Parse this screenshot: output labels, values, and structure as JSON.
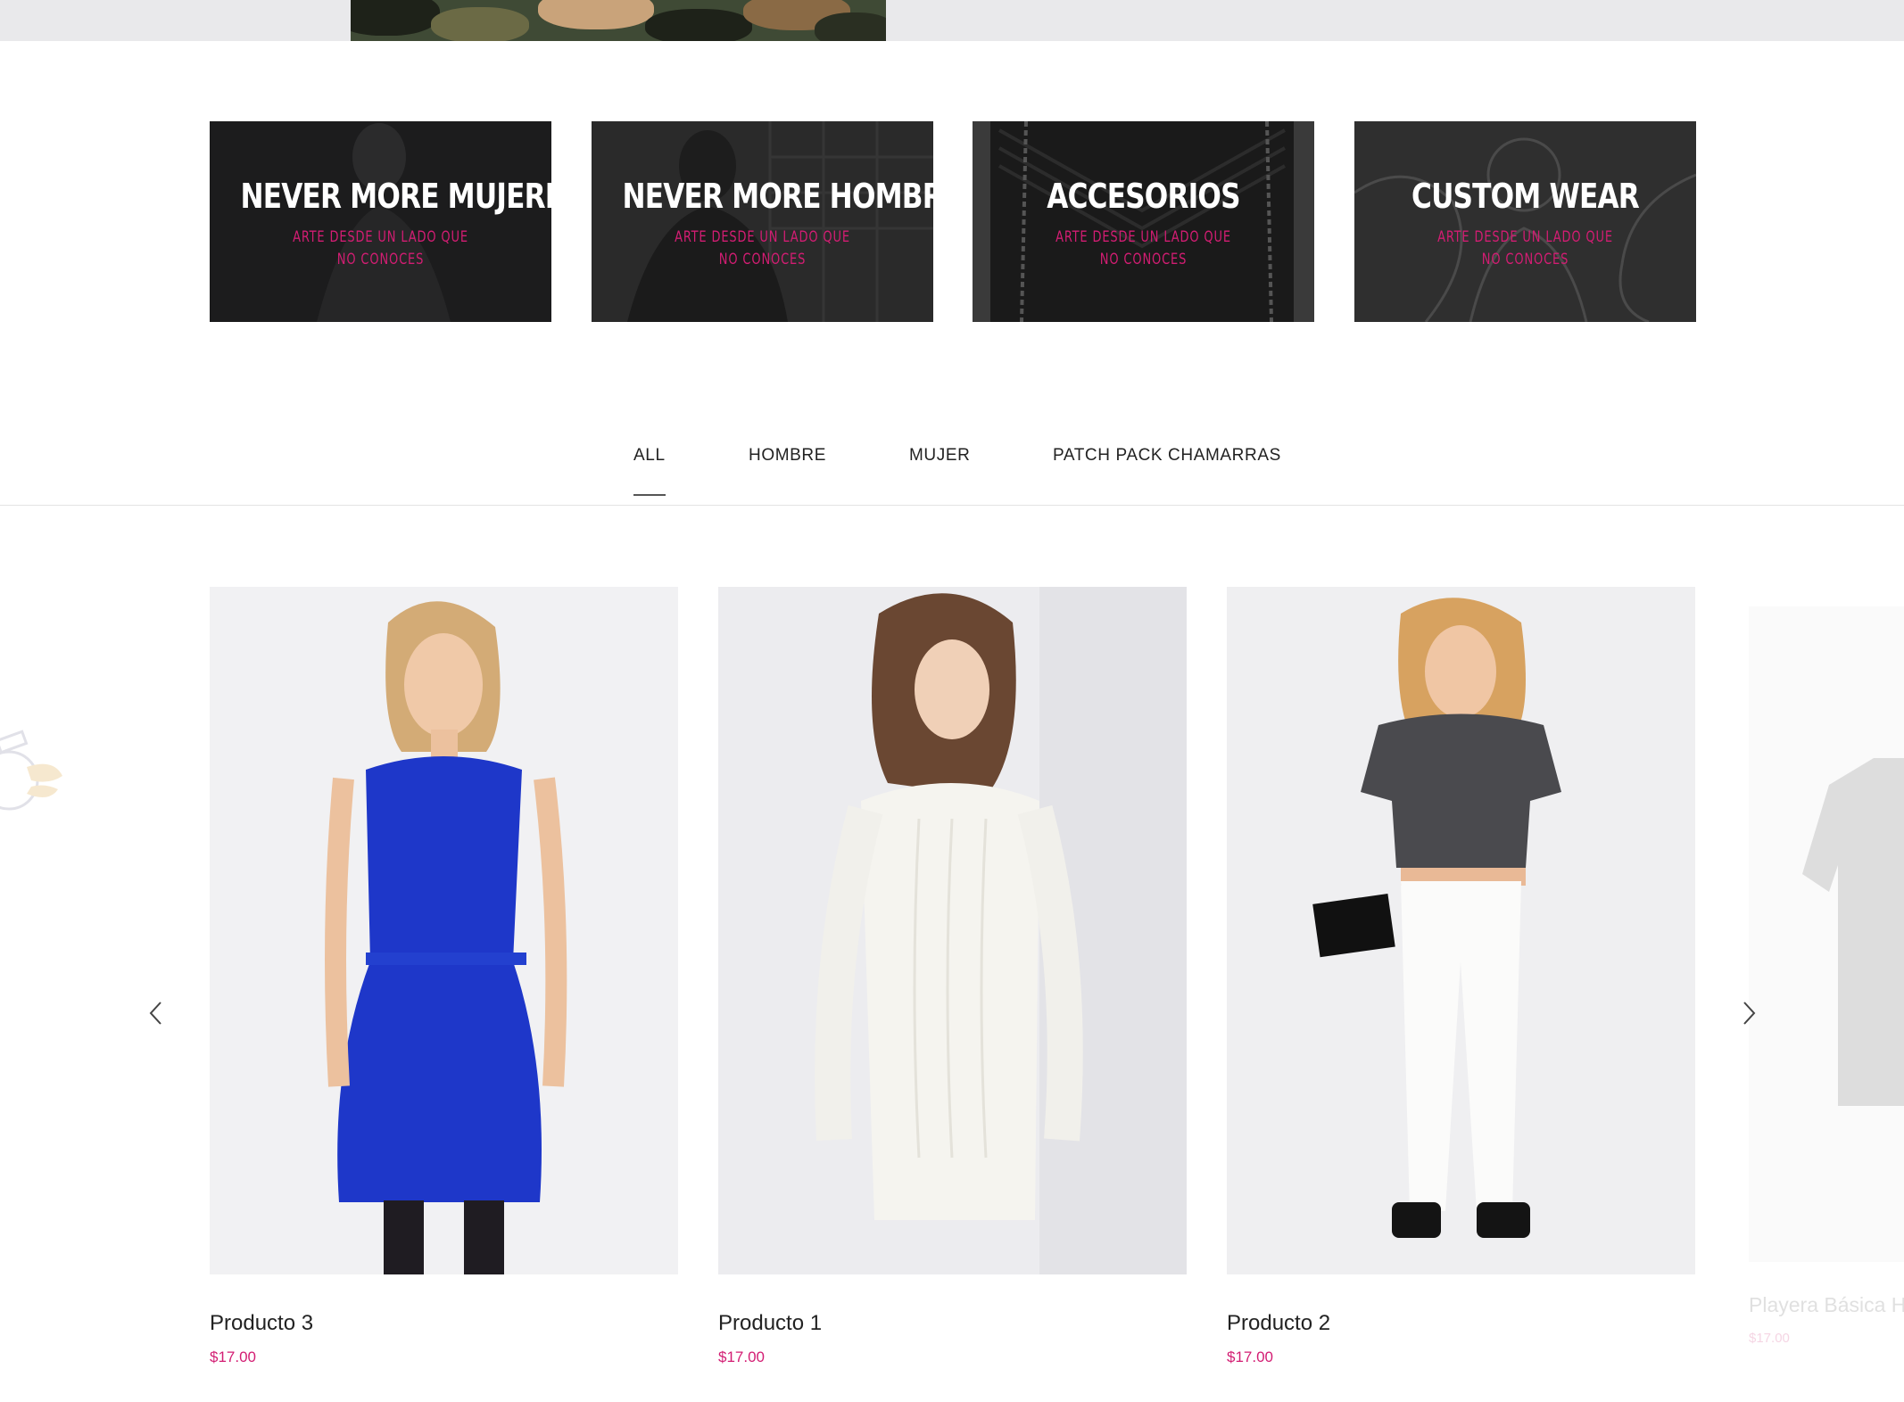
{
  "categories": [
    {
      "title": "NEVER MORE MUJERES",
      "subtitle": "ARTE DESDE UN LADO QUE NO CONOCES"
    },
    {
      "title": "NEVER MORE HOMBRES",
      "subtitle": "ARTE DESDE UN LADO QUE NO CONOCES"
    },
    {
      "title": "ACCESORIOS",
      "subtitle": "ARTE DESDE UN LADO QUE NO CONOCES"
    },
    {
      "title": "CUSTOM WEAR",
      "subtitle": "ARTE DESDE UN LADO QUE NO CONOCES"
    }
  ],
  "tabs": [
    {
      "label": "ALL",
      "active": true
    },
    {
      "label": "HOMBRE",
      "active": false
    },
    {
      "label": "MUJER",
      "active": false
    },
    {
      "label": "PATCH PACK CHAMARRAS",
      "active": false
    }
  ],
  "products": [
    {
      "name": "Producto 3",
      "price": "$17.00"
    },
    {
      "name": "Producto 1",
      "price": "$17.00"
    },
    {
      "name": "Producto 2",
      "price": "$17.00"
    },
    {
      "name": "Playera Básica H",
      "price": "$17.00"
    }
  ],
  "colors": {
    "accent": "#d31d73",
    "banner_bg": "#1f1f1f",
    "hero_bg": "#e9e9eb"
  },
  "icons": {
    "prev": "chevron-left-icon",
    "next": "chevron-right-icon"
  }
}
